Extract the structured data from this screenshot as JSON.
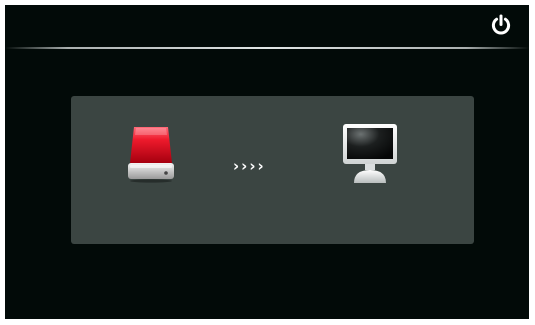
{
  "header": {
    "power_icon": "power-icon"
  },
  "transfer": {
    "source_icon": "external-drive-icon",
    "target_icon": "monitor-icon",
    "arrows": "››››"
  },
  "colors": {
    "screen_background": "#020a08",
    "panel_background": "#3b4542",
    "drive_red": "#e01020",
    "icon_white": "#ffffff"
  }
}
